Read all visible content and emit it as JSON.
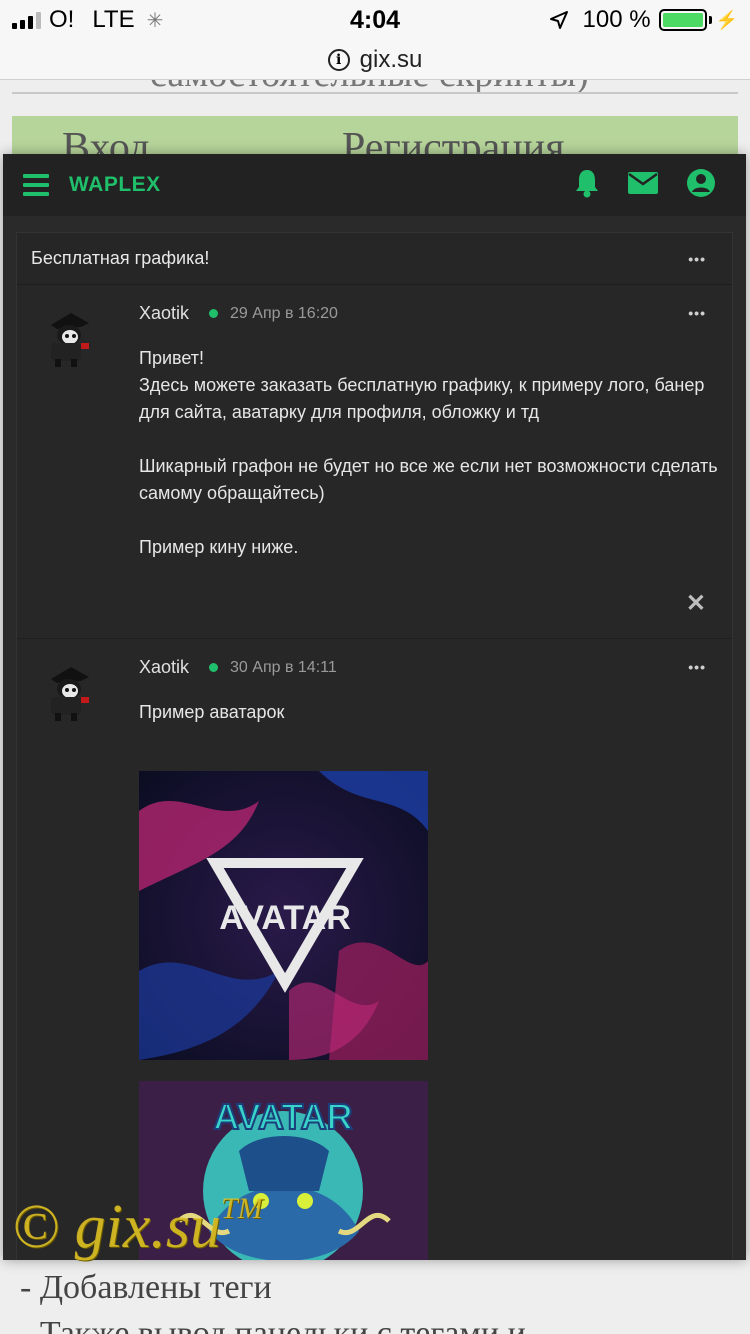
{
  "status_bar": {
    "carrier": "O!",
    "network": "LTE",
    "time": "4:04",
    "battery_text": "100 %",
    "battery_level": 1.0
  },
  "browser": {
    "host": "gix.su"
  },
  "background_page": {
    "top_text": "самостоятельные скрипты)",
    "login_label": "Вход",
    "register_label": "Регистрация",
    "bottom_lines": [
      "- Добавлены теги",
      "- Также вывод панельки с тегами и"
    ]
  },
  "app": {
    "brand": "WAPLEX",
    "accent": "#1fbf6b",
    "icons": [
      "menu-icon",
      "bell-icon",
      "mail-icon",
      "user-icon"
    ]
  },
  "thread": {
    "title": "Бесплатная графика!",
    "more": "•••",
    "posts": [
      {
        "author": "Xaotik",
        "date": "29 Апр в 16:20",
        "more": "•••",
        "paragraphs": [
          "Привет!\nЗдесь можете заказать бесплатную графику, к примеру лого, банер для сайта, аватарку для профиля, обложку и тд",
          "Шикарный графон не будет но все же если нет возможности сделать самому обращайтесь)",
          "Пример кину ниже."
        ],
        "close": "✕"
      },
      {
        "author": "Xaotik",
        "date": "30 Апр в 14:11",
        "more": "•••",
        "text": "Пример аватарок",
        "images": [
          {
            "caption": "AVATAR"
          },
          {
            "caption": "AVATAR"
          }
        ]
      }
    ]
  },
  "watermark": {
    "text": "© gix.su",
    "tm": "TM"
  }
}
